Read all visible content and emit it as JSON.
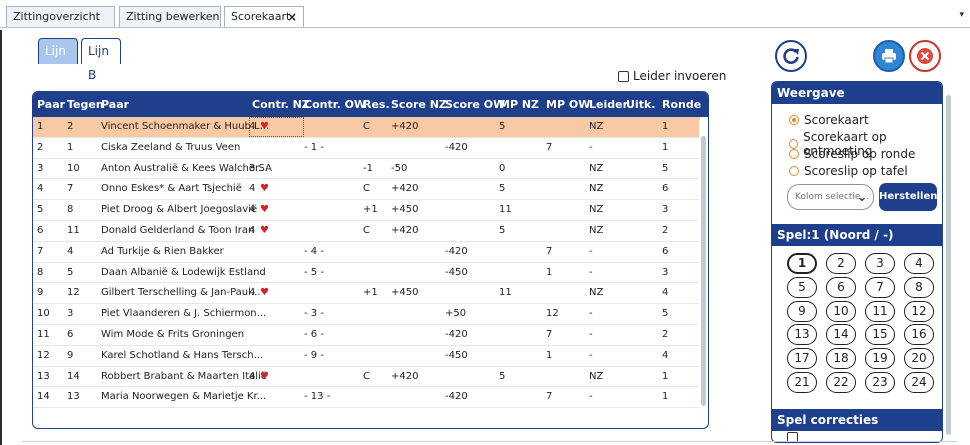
{
  "tabs": [
    {
      "label": "Zittingoverzicht"
    },
    {
      "label": "Zitting bewerken"
    },
    {
      "label": "Scorekaart",
      "close": "×"
    }
  ],
  "overflow_glyph": "▾",
  "lijn_tabs": [
    {
      "label": "Lijn A"
    },
    {
      "label": "Lijn B"
    }
  ],
  "leider_label": "Leider invoeren",
  "columns": [
    "Paar",
    "Tegen",
    "Paar",
    "Contr. NZ",
    "Contr. OW",
    "Res.",
    "Score NZ",
    "Score OW",
    "MP NZ",
    "MP OW",
    "Leider",
    "Uitk.",
    "Ronde"
  ],
  "rows": [
    {
      "paar": "1",
      "tegen": "2",
      "naam": "Vincent Schoenmaker & Huub L...",
      "cnz": "4",
      "heart": true,
      "cow": "",
      "res": "C",
      "snz": "+420",
      "sow": "",
      "mpnz": "5",
      "mpow": "",
      "leider": "NZ",
      "ronde": "1"
    },
    {
      "paar": "2",
      "tegen": "1",
      "naam": "Ciska Zeeland & Truus Veen",
      "cnz": "",
      "heart": false,
      "cow": "- 1 -",
      "res": "",
      "snz": "",
      "sow": "-420",
      "mpnz": "",
      "mpow": "7",
      "leider": "-",
      "ronde": "1"
    },
    {
      "paar": "3",
      "tegen": "10",
      "naam": "Anton Australië & Kees Walcher...",
      "cnz": "3 SA",
      "heart": false,
      "cow": "",
      "res": "-1",
      "snz": "-50",
      "sow": "",
      "mpnz": "0",
      "mpow": "",
      "leider": "NZ",
      "ronde": "5"
    },
    {
      "paar": "4",
      "tegen": "7",
      "naam": "Onno Eskes* & Aart Tsjechië",
      "cnz": "4",
      "heart": true,
      "cow": "",
      "res": "C",
      "snz": "+420",
      "sow": "",
      "mpnz": "5",
      "mpow": "",
      "leider": "NZ",
      "ronde": "6"
    },
    {
      "paar": "5",
      "tegen": "8",
      "naam": "Piet Droog & Albert Joegoslavië",
      "cnz": "4",
      "heart": true,
      "cow": "",
      "res": "+1",
      "snz": "+450",
      "sow": "",
      "mpnz": "11",
      "mpow": "",
      "leider": "NZ",
      "ronde": "3"
    },
    {
      "paar": "6",
      "tegen": "11",
      "naam": "Donald Gelderland & Toon Iran",
      "cnz": "4",
      "heart": true,
      "cow": "",
      "res": "C",
      "snz": "+420",
      "sow": "",
      "mpnz": "5",
      "mpow": "",
      "leider": "NZ",
      "ronde": "2"
    },
    {
      "paar": "7",
      "tegen": "4",
      "naam": "Ad Turkije & Rien Bakker",
      "cnz": "",
      "heart": false,
      "cow": "- 4 -",
      "res": "",
      "snz": "",
      "sow": "-420",
      "mpnz": "",
      "mpow": "7",
      "leider": "-",
      "ronde": "6"
    },
    {
      "paar": "8",
      "tegen": "5",
      "naam": "Daan Albanië & Lodewijk Estland",
      "cnz": "",
      "heart": false,
      "cow": "- 5 -",
      "res": "",
      "snz": "",
      "sow": "-450",
      "mpnz": "",
      "mpow": "1",
      "leider": "-",
      "ronde": "3"
    },
    {
      "paar": "9",
      "tegen": "12",
      "naam": "Gilbert Terschelling & Jan-Paul...",
      "cnz": "4",
      "heart": true,
      "cow": "",
      "res": "+1",
      "snz": "+450",
      "sow": "",
      "mpnz": "11",
      "mpow": "",
      "leider": "NZ",
      "ronde": "4"
    },
    {
      "paar": "10",
      "tegen": "3",
      "naam": "Piet Vlaanderen & J. Schiermon...",
      "cnz": "",
      "heart": false,
      "cow": "- 3 -",
      "res": "",
      "snz": "",
      "sow": "+50",
      "mpnz": "",
      "mpow": "12",
      "leider": "-",
      "ronde": "5"
    },
    {
      "paar": "11",
      "tegen": "6",
      "naam": "Wim Mode & Frits Groningen",
      "cnz": "",
      "heart": false,
      "cow": "- 6 -",
      "res": "",
      "snz": "",
      "sow": "-420",
      "mpnz": "",
      "mpow": "7",
      "leider": "-",
      "ronde": "2"
    },
    {
      "paar": "12",
      "tegen": "9",
      "naam": "Karel Schotland & Hans Tersch...",
      "cnz": "",
      "heart": false,
      "cow": "- 9 -",
      "res": "",
      "snz": "",
      "sow": "-450",
      "mpnz": "",
      "mpow": "1",
      "leider": "-",
      "ronde": "4"
    },
    {
      "paar": "13",
      "tegen": "14",
      "naam": "Robbert Brabant & Maarten Italië",
      "cnz": "4",
      "heart": true,
      "cow": "",
      "res": "C",
      "snz": "+420",
      "sow": "",
      "mpnz": "5",
      "mpow": "",
      "leider": "NZ",
      "ronde": "1"
    },
    {
      "paar": "14",
      "tegen": "13",
      "naam": "Maria Noorwegen & Marietje Kr...",
      "cnz": "",
      "heart": false,
      "cow": "- 13 -",
      "res": "",
      "snz": "",
      "sow": "-420",
      "mpnz": "",
      "mpow": "7",
      "leider": "-",
      "ronde": "1"
    }
  ],
  "heart_glyph": "♥",
  "weergave": {
    "title": "Weergave",
    "options": [
      "Scorekaart",
      "Scorekaart op ontmoeting",
      "Scoreslip op ronde",
      "Scoreslip op tafel"
    ],
    "selected_index": 0,
    "select_placeholder": "Kolom selectie...",
    "select_chevron": "⌄",
    "herstel_label": "Herstellen"
  },
  "spel": {
    "title": "Spel:1 (Noord / -)",
    "boards": [
      "1",
      "2",
      "3",
      "4",
      "5",
      "6",
      "7",
      "8",
      "9",
      "10",
      "11",
      "12",
      "13",
      "14",
      "15",
      "16",
      "17",
      "18",
      "19",
      "20",
      "21",
      "22",
      "23",
      "24"
    ],
    "active": "1"
  },
  "correcties_title": "Spel correcties",
  "colors": {
    "header": "#1d3f8c",
    "selected_row": "#f8c9a5",
    "heart": "#d4232a",
    "radio": "#e08a2e"
  }
}
